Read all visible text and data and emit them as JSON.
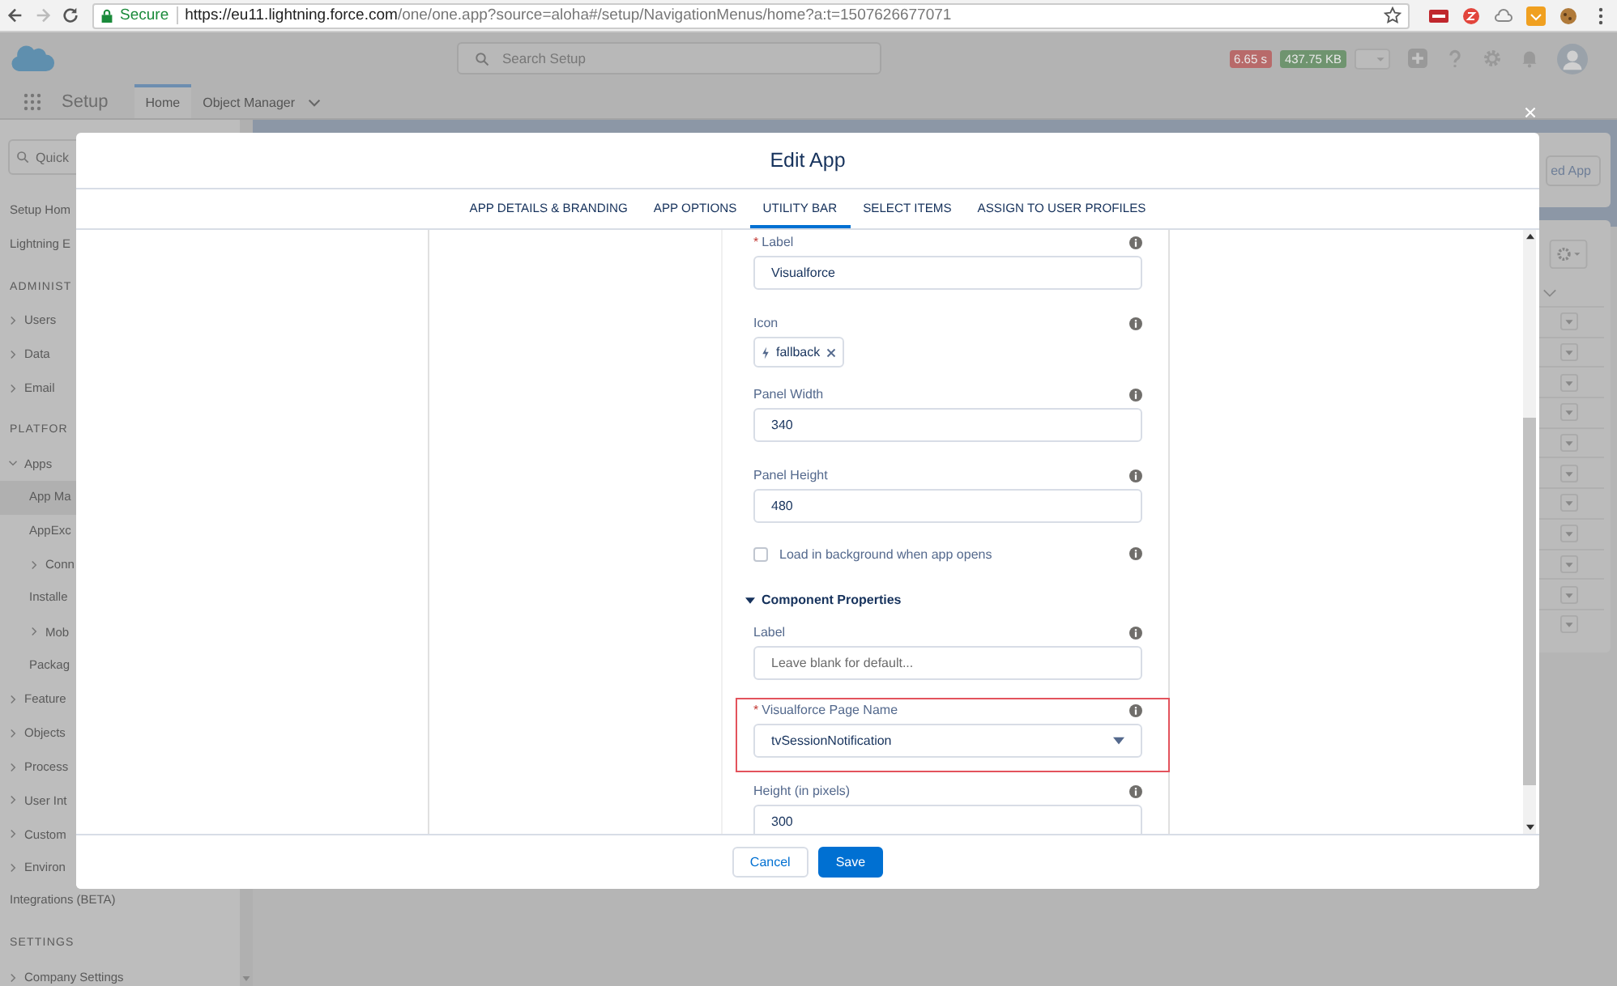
{
  "browser": {
    "secure_label": "Secure",
    "url_host": "https://eu11.lightning.force.com",
    "url_path": "/one/one.app?source=aloha#/setup/NavigationMenus/home?a:t=1507626677071"
  },
  "header": {
    "search_placeholder": "Search Setup",
    "badges": [
      {
        "text": "6.65 s",
        "color": "#b86a6a"
      },
      {
        "text": "437.75 KB",
        "color": "#6f946f"
      }
    ]
  },
  "nav": {
    "app_name": "Setup",
    "tabs": [
      {
        "label": "Home",
        "selected": true,
        "menu": false
      },
      {
        "label": "Object Manager",
        "selected": false,
        "menu": true
      }
    ]
  },
  "sidebar": {
    "search_placeholder": "Quick",
    "items": [
      {
        "kind": "link",
        "label": "Setup Hom"
      },
      {
        "kind": "link",
        "label": "Lightning E"
      },
      {
        "kind": "heading",
        "label": "ADMINIST"
      },
      {
        "kind": "group",
        "label": "Users",
        "expanded": false
      },
      {
        "kind": "group",
        "label": "Data",
        "expanded": false
      },
      {
        "kind": "group",
        "label": "Email",
        "expanded": false
      },
      {
        "kind": "heading",
        "label": "PLATFOR"
      },
      {
        "kind": "group",
        "label": "Apps",
        "expanded": true
      },
      {
        "kind": "child",
        "label": "App Ma",
        "selected": true
      },
      {
        "kind": "child",
        "label": "AppExc",
        "selected": false
      },
      {
        "kind": "subgroup",
        "label": "Conn",
        "expanded": false
      },
      {
        "kind": "child",
        "label": "Installe",
        "selected": false
      },
      {
        "kind": "subgroup",
        "label": "Mob",
        "expanded": false
      },
      {
        "kind": "child",
        "label": "Packag",
        "selected": false
      },
      {
        "kind": "group",
        "label": "Feature",
        "expanded": false
      },
      {
        "kind": "group",
        "label": "Objects",
        "expanded": false
      },
      {
        "kind": "group",
        "label": "Process",
        "expanded": false
      },
      {
        "kind": "group",
        "label": "User Int",
        "expanded": false
      },
      {
        "kind": "group",
        "label": "Custom",
        "expanded": false
      },
      {
        "kind": "group",
        "label": "Environ",
        "expanded": false
      },
      {
        "kind": "link",
        "label": "Integrations (BETA)"
      },
      {
        "kind": "heading",
        "label": "SETTINGS"
      },
      {
        "kind": "group",
        "label": "Company Settings",
        "expanded": false
      }
    ]
  },
  "main": {
    "new_button": "ed App"
  },
  "modal": {
    "title": "Edit App",
    "tabs": [
      {
        "label": "APP DETAILS & BRANDING",
        "selected": false
      },
      {
        "label": "APP OPTIONS",
        "selected": false
      },
      {
        "label": "UTILITY BAR",
        "selected": true
      },
      {
        "label": "SELECT ITEMS",
        "selected": false
      },
      {
        "label": "ASSIGN TO USER PROFILES",
        "selected": false
      }
    ],
    "fields": [
      {
        "kind": "text",
        "label": "Label",
        "marker": "*",
        "value": "Visualforce"
      },
      {
        "kind": "icon",
        "label": "Icon",
        "value": "fallback"
      },
      {
        "kind": "text",
        "label": "Panel Width",
        "value": "340"
      },
      {
        "kind": "text",
        "label": "Panel Height",
        "value": "480"
      },
      {
        "kind": "checkbox",
        "label": "Load in background when app opens",
        "checked": false
      },
      {
        "kind": "section",
        "label": "Component Properties",
        "expanded": true
      },
      {
        "kind": "text",
        "label": "Label",
        "placeholder": "Leave blank for default..."
      },
      {
        "kind": "select",
        "label": "Visualforce Page Name",
        "marker": "*",
        "value": "tvSessionNotification",
        "highlighted": true
      },
      {
        "kind": "text",
        "label": "Height (in pixels)",
        "value": "300"
      }
    ],
    "buttons": [
      {
        "label": "Cancel",
        "kind": "neutral"
      },
      {
        "label": "Save",
        "kind": "brand"
      }
    ]
  }
}
